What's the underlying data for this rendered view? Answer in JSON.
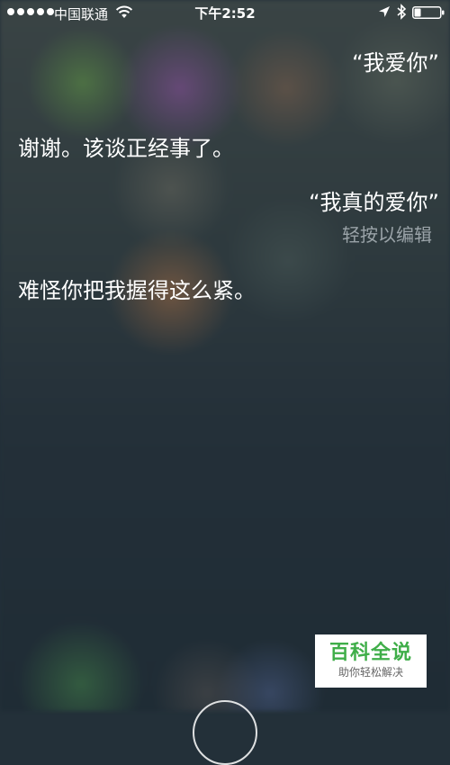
{
  "status_bar": {
    "carrier": "中国联通",
    "time": "下午2:52",
    "signal_dots": 5,
    "icons": [
      "signal-dots-icon",
      "wifi-icon",
      "location-arrow-icon",
      "bluetooth-icon",
      "battery-icon"
    ],
    "battery_level": 0.25
  },
  "conversation": {
    "user_1": "“我爱你”",
    "siri_1": "谢谢。该谈正经事了。",
    "user_2": "“我真的爱你”",
    "tap_to_edit": "轻按以编辑",
    "siri_2": "难怪你把我握得这么紧。"
  },
  "watermark": {
    "title": "百科全说",
    "subtitle": "助你轻松解决"
  },
  "colors": {
    "text": "#ffffff",
    "hint": "#9aa3a8",
    "watermark_green": "#3fae49",
    "background": "#233039"
  }
}
